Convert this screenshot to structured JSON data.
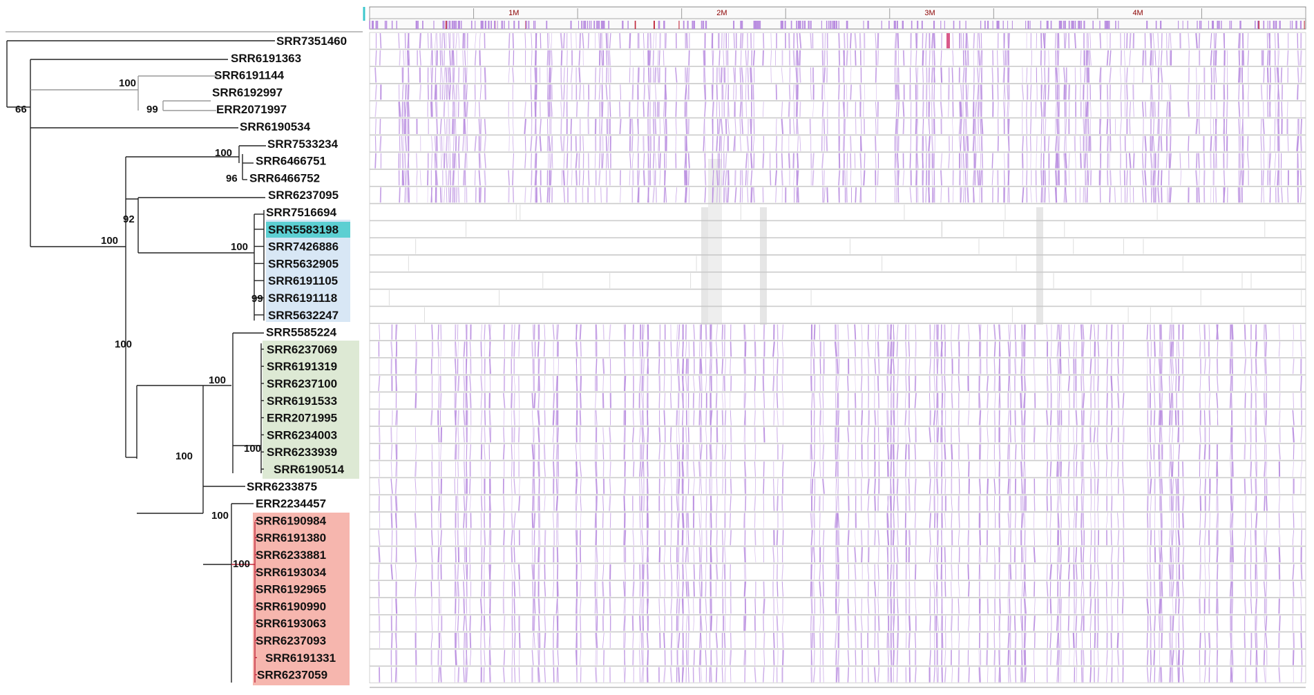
{
  "taxa": [
    "SRR7351460",
    "SRR6191363",
    "SRR6191144",
    "SRR6192997",
    "ERR2071997",
    "SRR6190534",
    "SRR7533234",
    "SRR6466751",
    "SRR6466752",
    "SRR6237095",
    "SRR7516694",
    "SRR5583198",
    "SRR7426886",
    "SRR5632905",
    "SRR6191105",
    "SRR6191118",
    "SRR5632247",
    "SRR5585224",
    "SRR6237069",
    "SRR6191319",
    "SRR6237100",
    "SRR6191533",
    "ERR2071995",
    "SRR6234003",
    "SRR6233939",
    "SRR6190514",
    "SRR6233875",
    "ERR2234457",
    "SRR6190984",
    "SRR6191380",
    "SRR6233881",
    "SRR6193034",
    "SRR6192965",
    "SRR6190990",
    "SRR6193063",
    "SRR6237093",
    "SRR6191331",
    "SRR6237059"
  ],
  "bootstraps": [
    {
      "id": "b66",
      "value": "66"
    },
    {
      "id": "b100a",
      "value": "100"
    },
    {
      "id": "b99a",
      "value": "99"
    },
    {
      "id": "b100root",
      "value": "100"
    },
    {
      "id": "b92",
      "value": "92"
    },
    {
      "id": "b100b",
      "value": "100"
    },
    {
      "id": "b96",
      "value": "96"
    },
    {
      "id": "b100c",
      "value": "100"
    },
    {
      "id": "b99b",
      "value": "99"
    },
    {
      "id": "b100d",
      "value": "100"
    },
    {
      "id": "b100e",
      "value": "100"
    },
    {
      "id": "b100f",
      "value": "100"
    },
    {
      "id": "b100g",
      "value": "100"
    },
    {
      "id": "b100h",
      "value": "100"
    },
    {
      "id": "b100i",
      "value": "100"
    }
  ],
  "clade_colors": {
    "cyan": "#5ccfd2",
    "blue": "#d8e7f5",
    "green": "#dde9d4",
    "red": "#f6b6ae",
    "mark": "#b98de0",
    "ruler_red": "#c0283c"
  },
  "ruler_labels": [
    "1M",
    "2M",
    "3M",
    "4M"
  ]
}
